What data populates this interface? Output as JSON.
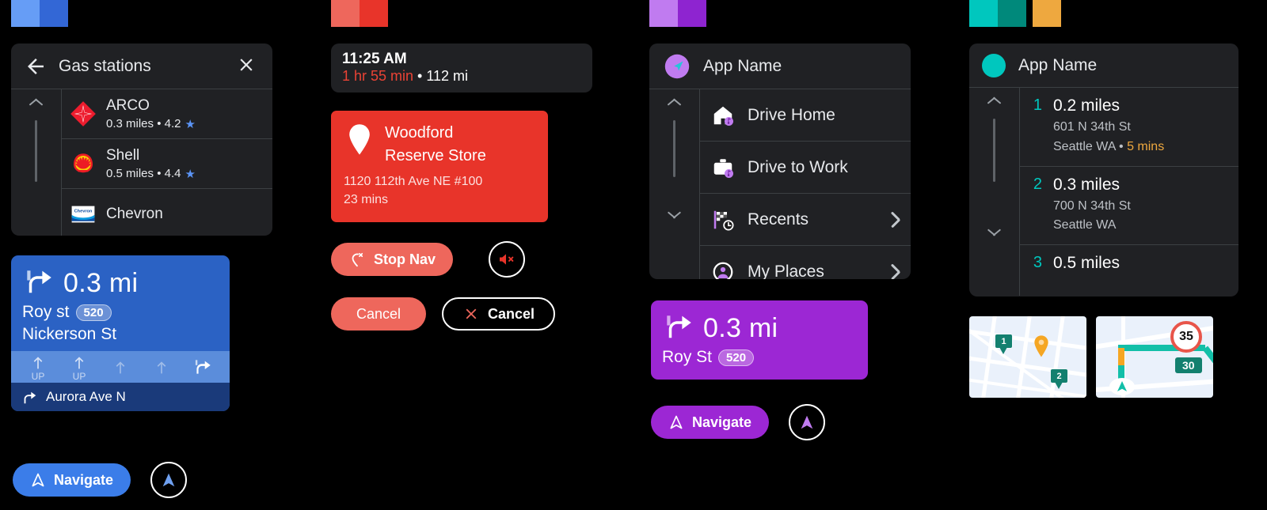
{
  "columns": {
    "blue": {
      "swatches": [
        "#669DF6",
        "#3367D6"
      ],
      "accent": "#3367D6",
      "list_panel": {
        "back_icon": "back-arrow-icon",
        "title": "Gas stations",
        "close_icon": "close-icon",
        "items": [
          {
            "name": "ARCO",
            "sub": "0.3 miles • 4.2",
            "rating_icon": "star-icon",
            "brand_icon": "arco-logo"
          },
          {
            "name": "Shell",
            "sub": "0.5 miles • 4.4",
            "rating_icon": "star-icon",
            "brand_icon": "shell-logo"
          },
          {
            "name": "Chevron",
            "sub": "",
            "rating_icon": "",
            "brand_icon": "chevron-logo"
          }
        ]
      },
      "nav_card": {
        "maneuver_icon": "turn-right-icon",
        "distance": "0.3 mi",
        "street": "Roy st",
        "shield": "520",
        "street2": "Nickerson St",
        "lanes": [
          {
            "icon": "lane-straight-icon",
            "label": "UP",
            "active": false
          },
          {
            "icon": "lane-straight-icon",
            "label": "UP",
            "active": false
          },
          {
            "icon": "lane-straight-icon",
            "label": "",
            "active": false
          },
          {
            "icon": "lane-straight-icon",
            "label": "",
            "active": false
          },
          {
            "icon": "lane-turn-right-icon",
            "label": "",
            "active": true
          }
        ],
        "next_step_icon": "turn-right-icon",
        "next_step": "Aurora Ave N"
      },
      "navigate_button": {
        "label": "Navigate",
        "icon": "navigation-arrow-icon"
      },
      "recenter_button": {
        "icon": "recenter-arrow-icon"
      }
    },
    "red": {
      "swatches": [
        "#EE675C",
        "#E8342A"
      ],
      "accent": "#E8342A",
      "eta": {
        "time": "11:25 AM",
        "duration": "1 hr 55 min",
        "separator": " • ",
        "distance": "112 mi"
      },
      "destination": {
        "pin_icon": "map-pin-icon",
        "name_line1": "Woodford",
        "name_line2": "Reserve Store",
        "address": "1120 112th Ave NE #100",
        "eta": "23 mins"
      },
      "stop_nav_button": {
        "label": "Stop Nav",
        "icon": "stop-navigation-icon"
      },
      "mute_button": {
        "icon": "volume-mute-icon"
      },
      "cancel_filled": {
        "label": "Cancel"
      },
      "cancel_outlined": {
        "label": "Cancel",
        "icon": "close-x-icon"
      }
    },
    "purple": {
      "swatches": [
        "#C07BF0",
        "#8E24D0"
      ],
      "accent": "#9C27D4",
      "app_panel": {
        "app_icon": "app-navigation-icon",
        "title": "App Name",
        "menu": [
          {
            "label": "Drive Home",
            "icon": "home-icon",
            "chevron": false
          },
          {
            "label": "Drive to Work",
            "icon": "briefcase-icon",
            "chevron": false
          },
          {
            "label": "Recents",
            "icon": "checkered-flag-clock-icon",
            "chevron": true
          },
          {
            "label": "My Places",
            "icon": "person-pin-icon",
            "chevron": true
          }
        ]
      },
      "nav_card": {
        "maneuver_icon": "turn-right-icon",
        "distance": "0.3 mi",
        "street": "Roy St",
        "shield": "520"
      },
      "navigate_button": {
        "label": "Navigate",
        "icon": "navigation-arrow-icon"
      },
      "recenter_button": {
        "icon": "recenter-arrow-icon"
      }
    },
    "teal": {
      "swatches": [
        "#00C7BE",
        "#00897B",
        "#EEA83F"
      ],
      "accent": "#00C7BE",
      "app_panel": {
        "app_icon": "app-dot-icon",
        "title": "App Name",
        "steps": [
          {
            "num": "1",
            "distance": "0.2 miles",
            "line1": "601 N 34th St",
            "line2_city": "Seattle WA",
            "line2_sep": " • ",
            "line2_mins": "5 mins"
          },
          {
            "num": "2",
            "distance": "0.3 miles",
            "line1": "700 N 34th St",
            "line2_city": "Seattle WA",
            "line2_sep": "",
            "line2_mins": ""
          },
          {
            "num": "3",
            "distance": "0.5 miles",
            "line1": "",
            "line2_city": "",
            "line2_sep": "",
            "line2_mins": ""
          }
        ]
      },
      "map_thumb_a": {
        "marker1": "1",
        "marker2": "2",
        "poi_icon": "poi-pin-icon"
      },
      "map_thumb_b": {
        "speed_limit": "35",
        "route_badge": "30",
        "vehicle_icon": "vehicle-arrow-icon"
      }
    }
  }
}
